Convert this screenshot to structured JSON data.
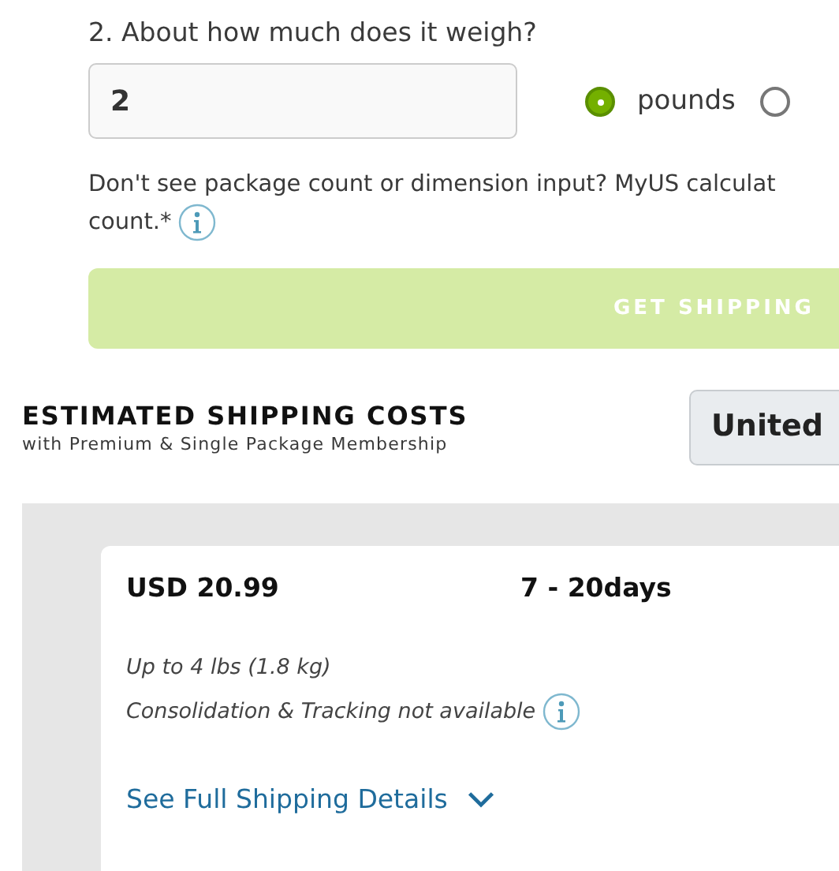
{
  "question": {
    "label": "2. About how much does it weigh?",
    "value": "2",
    "units": [
      {
        "label": "pounds",
        "selected": true
      },
      {
        "selected": false
      }
    ]
  },
  "note": {
    "lines": [
      "Don't see package count or dimension input? MyUS calculat",
      "count.*"
    ]
  },
  "submit_button": "GET SHIPPING",
  "estimate": {
    "title": "ESTIMATED SHIPPING COSTS",
    "subtitle": "with Premium & Single Package Membership",
    "country": "United"
  },
  "result": {
    "price": "USD 20.99",
    "days": "7 - 20days",
    "weight_limit": "Up to 4 lbs (1.8 kg)",
    "tracking": "Consolidation & Tracking not available",
    "details_link": "See Full Shipping Details"
  }
}
